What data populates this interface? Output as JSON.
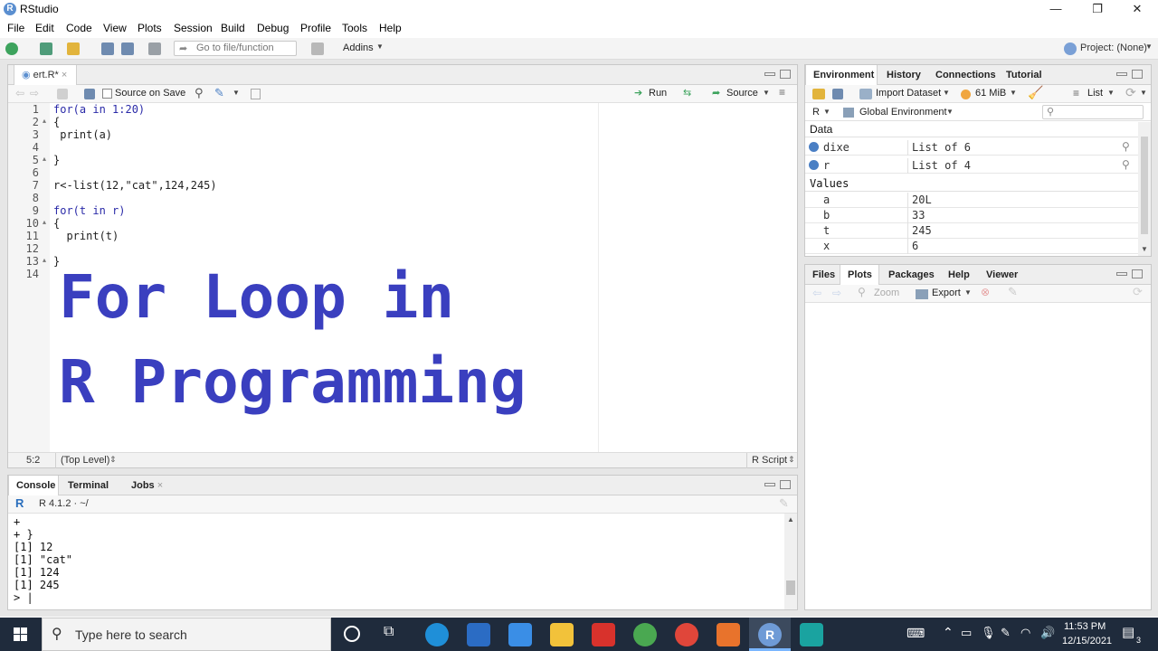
{
  "window": {
    "title": "RStudio",
    "logo_letter": "R",
    "minimize": "—",
    "restore": "❐",
    "close": "✕"
  },
  "menu": [
    "File",
    "Edit",
    "Code",
    "View",
    "Plots",
    "Session",
    "Build",
    "Debug",
    "Profile",
    "Tools",
    "Help"
  ],
  "toolbar": {
    "goto_placeholder": "Go to file/function",
    "addins": "Addins",
    "project": "Project: (None)"
  },
  "editor": {
    "tab_name": "ert.R*",
    "source_on_save": "Source on Save",
    "run": "Run",
    "source": "Source",
    "line_numbers": [
      "1",
      "2",
      "3",
      "4",
      "5",
      "6",
      "7",
      "8",
      "9",
      "10",
      "11",
      "12",
      "13",
      "14"
    ],
    "code": [
      "for(a in 1:20)",
      "{",
      " print(a)",
      "",
      "}",
      "",
      "r<-list(12,\"cat\",124,245)",
      "",
      "for(t in r)",
      "{",
      "  print(t)",
      "",
      "}",
      ""
    ],
    "overlay_line1": "For Loop in",
    "overlay_line2": "R Programming",
    "status_pos": "5:2",
    "status_scope": "(Top Level)",
    "status_type": "R Script"
  },
  "environment": {
    "tabs": [
      "Environment",
      "History",
      "Connections",
      "Tutorial"
    ],
    "import_dataset": "Import Dataset",
    "memory": "61 MiB",
    "list_view": "List",
    "lang": "R",
    "scope": "Global Environment",
    "section_data": "Data",
    "data_rows": [
      {
        "name": "dixe",
        "value": "List of  6"
      },
      {
        "name": "r",
        "value": "List of  4"
      }
    ],
    "section_values": "Values",
    "value_rows": [
      {
        "name": "a",
        "value": "20L"
      },
      {
        "name": "b",
        "value": "33"
      },
      {
        "name": "t",
        "value": "245"
      },
      {
        "name": "x",
        "value": "6"
      }
    ]
  },
  "files": {
    "tabs": [
      "Files",
      "Plots",
      "Packages",
      "Help",
      "Viewer"
    ],
    "zoom": "Zoom",
    "export": "Export"
  },
  "console": {
    "tabs": [
      "Console",
      "Terminal",
      "Jobs"
    ],
    "version": "R 4.1.2 · ~/",
    "lines": [
      "+",
      "+ }",
      "[1] 12",
      "[1] \"cat\"",
      "[1] 124",
      "[1] 245",
      "> |"
    ]
  },
  "taskbar": {
    "search_placeholder": "Type here to search",
    "time": "11:53 PM",
    "date": "12/15/2021",
    "notifications": "3"
  },
  "colors": {
    "overlay_text": "#3a3fbf",
    "keyword": "#2a2aa8",
    "taskbar": "#1f2b3c"
  }
}
